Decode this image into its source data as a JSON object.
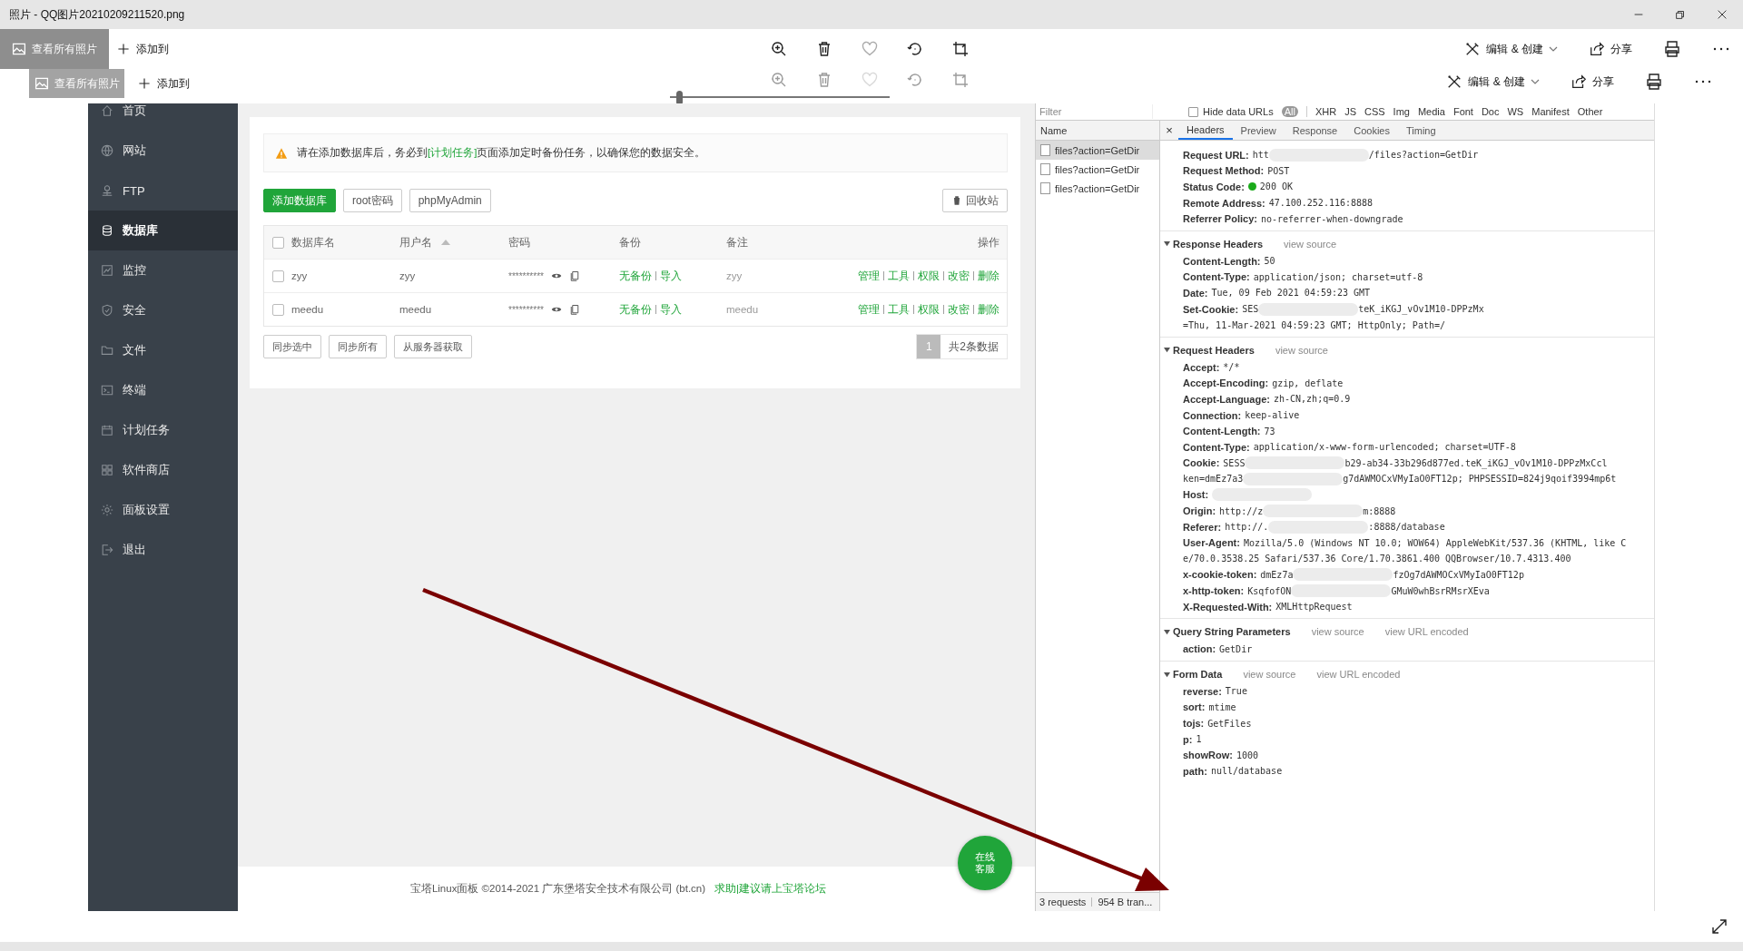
{
  "window": {
    "title": "照片 - QQ图片20210209211520.png"
  },
  "toolbar": {
    "view_all": "查看所有照片",
    "add_to": "添加到",
    "edit": "编辑 & 创建",
    "share": "分享"
  },
  "image": {
    "toolbar": {
      "view_all": "查看所有照片",
      "add_to": "添加到",
      "edit": "编辑 & 创建",
      "share": "分享"
    },
    "zoom_slider": {
      "level": 0.03
    },
    "panel": {
      "sidebar": [
        {
          "label": "首页",
          "selected": false
        },
        {
          "label": "网站",
          "selected": false
        },
        {
          "label": "FTP",
          "selected": false
        },
        {
          "label": "数据库",
          "selected": true
        },
        {
          "label": "监控",
          "selected": false
        },
        {
          "label": "安全",
          "selected": false
        },
        {
          "label": "文件",
          "selected": false
        },
        {
          "label": "终端",
          "selected": false
        },
        {
          "label": "计划任务",
          "selected": false
        },
        {
          "label": "软件商店",
          "selected": false
        },
        {
          "label": "面板设置",
          "selected": false
        },
        {
          "label": "退出",
          "selected": false
        }
      ],
      "notice": {
        "before": "请在添加数据库后，务必到",
        "link": "[计划任务]",
        "after": "页面添加定时备份任务，以确保您的数据安全。"
      },
      "buttons": [
        {
          "label": "添加数据库",
          "kind": "primary"
        },
        {
          "label": "root密码",
          "kind": "plain"
        },
        {
          "label": "phpMyAdmin",
          "kind": "plain"
        }
      ],
      "recycle": "回收站",
      "table": {
        "all_checked": false,
        "separator": "|",
        "columns": [
          "数据库名",
          "用户名",
          "密码",
          "备份",
          "备注",
          "操作"
        ],
        "rows": [
          {
            "checked": false,
            "name": "zyy",
            "user": "zyy",
            "password": "**********",
            "backup": [
              "无备份",
              "导入"
            ],
            "note": "zyy",
            "actions": [
              "管理",
              "工具",
              "权限",
              "改密",
              "删除"
            ]
          },
          {
            "checked": false,
            "name": "meedu",
            "user": "meedu",
            "password": "**********",
            "backup": [
              "无备份",
              "导入"
            ],
            "note": "meedu",
            "actions": [
              "管理",
              "工具",
              "权限",
              "改密",
              "删除"
            ]
          }
        ]
      },
      "sync_buttons": [
        "同步选中",
        "同步所有",
        "从服务器获取"
      ],
      "pagination": {
        "page": "1",
        "total": "共2条数据"
      },
      "footer": {
        "text": "宝塔Linux面板 ©2014-2021 广东堡塔安全技术有限公司 (bt.cn)",
        "link": "求助|建议请上宝塔论坛"
      },
      "chat": [
        "在线",
        "客服"
      ]
    },
    "devtools": {
      "filter": {
        "placeholder": "Filter"
      },
      "hide_data_urls": {
        "label": "Hide data URLs",
        "checked": false
      },
      "types": [
        {
          "label": "All",
          "selected": true
        },
        {
          "label": "XHR",
          "selected": false
        },
        {
          "label": "JS",
          "selected": false
        },
        {
          "label": "CSS",
          "selected": false
        },
        {
          "label": "Img",
          "selected": false
        },
        {
          "label": "Media",
          "selected": false
        },
        {
          "label": "Font",
          "selected": false
        },
        {
          "label": "Doc",
          "selected": false
        },
        {
          "label": "WS",
          "selected": false
        },
        {
          "label": "Manifest",
          "selected": false
        },
        {
          "label": "Other",
          "selected": false
        }
      ],
      "name_header": "Name",
      "requests": [
        {
          "label": "files?action=GetDir",
          "selected": true
        },
        {
          "label": "files?action=GetDir",
          "selected": false
        },
        {
          "label": "files?action=GetDir",
          "selected": false
        }
      ],
      "close": "×",
      "tabs": [
        {
          "label": "Headers",
          "selected": true
        },
        {
          "label": "Preview",
          "selected": false
        },
        {
          "label": "Response",
          "selected": false
        },
        {
          "label": "Cookies",
          "selected": false
        },
        {
          "label": "Timing",
          "selected": false
        }
      ],
      "general": [
        {
          "name": "Request URL:",
          "value": "htt",
          "redacted": true,
          "value_after": "/files?action=GetDir"
        },
        {
          "name": "Request Method:",
          "value": "POST"
        },
        {
          "name": "Status Code:",
          "ok": true,
          "value": "200 OK"
        },
        {
          "name": "Remote Address:",
          "value": "47.100.252.116:8888"
        },
        {
          "name": "Referrer Policy:",
          "value": "no-referrer-when-downgrade"
        }
      ],
      "sections": [
        {
          "title": "Response Headers",
          "expanded": true,
          "links": [
            "view source"
          ],
          "rows": [
            {
              "name": "Content-Length:",
              "value": "50"
            },
            {
              "name": "Content-Type:",
              "value": "application/json; charset=utf-8"
            },
            {
              "name": "Date:",
              "value": "Tue, 09 Feb 2021 04:59:23 GMT"
            },
            {
              "name": "Set-Cookie:",
              "value": "SES",
              "redacted": true,
              "value_after": "teK_iKGJ_vOv1M10-DPPzMx"
            },
            {
              "value": "=Thu, 11-Mar-2021 04:59:23 GMT; HttpOnly; Path=/"
            }
          ]
        },
        {
          "title": "Request Headers",
          "expanded": true,
          "links": [
            "view source"
          ],
          "rows": [
            {
              "name": "Accept:",
              "value": "*/*"
            },
            {
              "name": "Accept-Encoding:",
              "value": "gzip, deflate"
            },
            {
              "name": "Accept-Language:",
              "value": "zh-CN,zh;q=0.9"
            },
            {
              "name": "Connection:",
              "value": "keep-alive"
            },
            {
              "name": "Content-Length:",
              "value": "73"
            },
            {
              "name": "Content-Type:",
              "value": "application/x-www-form-urlencoded; charset=UTF-8"
            },
            {
              "name": "Cookie:",
              "value": "SESS",
              "redacted": true,
              "value_after": "b29-ab34-33b296d877ed.teK_iKGJ_vOv1M10-DPPzMxCcl"
            },
            {
              "value": "ken=dmEz7a3",
              "redacted": true,
              "value_after": "g7dAWMOCxVMyIaO0FT12p; PHPSESSID=824j9qoif3994mp6t"
            },
            {
              "name": "Host:",
              "redacted": true
            },
            {
              "name": "Origin:",
              "value": "http://z",
              "redacted": true,
              "value_after": "m:8888"
            },
            {
              "name": "Referer:",
              "value": "http://.",
              "redacted": true,
              "value_after": ":8888/database"
            },
            {
              "name": "User-Agent:",
              "value": "Mozilla/5.0 (Windows NT 10.0; WOW64) AppleWebKit/537.36 (KHTML, like C"
            },
            {
              "value": "e/70.0.3538.25 Safari/537.36 Core/1.70.3861.400 QQBrowser/10.7.4313.400"
            },
            {
              "name": "x-cookie-token:",
              "value": "dmEz7a",
              "redacted": true,
              "value_after": "fzOg7dAWMOCxVMyIaO0FT12p"
            },
            {
              "name": "x-http-token:",
              "value": "KsqfofON",
              "redacted": true,
              "value_after": "GMuW0whBsrRMsrXEva"
            },
            {
              "name": "X-Requested-With:",
              "value": "XMLHttpRequest"
            }
          ]
        },
        {
          "title": "Query String Parameters",
          "expanded": true,
          "links": [
            "view source",
            "view URL encoded"
          ],
          "rows": [
            {
              "name": "action:",
              "value": "GetDir"
            }
          ]
        },
        {
          "title": "Form Data",
          "expanded": true,
          "links": [
            "view source",
            "view URL encoded"
          ],
          "rows": [
            {
              "name": "reverse:",
              "value": "True"
            },
            {
              "name": "sort:",
              "value": "mtime"
            },
            {
              "name": "tojs:",
              "value": "GetFiles"
            },
            {
              "name": "p:",
              "value": "1"
            },
            {
              "name": "showRow:",
              "value": "1000"
            },
            {
              "name": "path:",
              "value": "null/database"
            }
          ]
        }
      ],
      "status": "3 requests",
      "transferred": "954 B tran..."
    }
  }
}
